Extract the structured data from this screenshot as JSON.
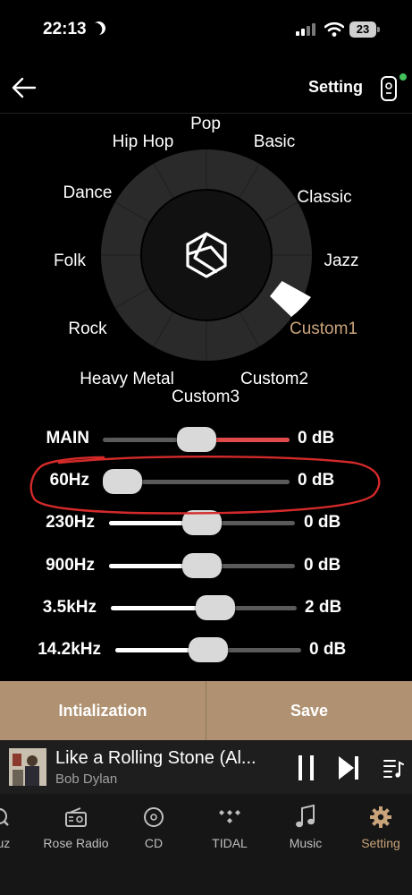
{
  "status_bar": {
    "time": "22:13",
    "battery": "23"
  },
  "header": {
    "title": "Setting"
  },
  "dial": {
    "labels": {
      "pop": "Pop",
      "hiphop": "Hip Hop",
      "basic": "Basic",
      "dance": "Dance",
      "classic": "Classic",
      "folk": "Folk",
      "jazz": "Jazz",
      "rock": "Rock",
      "custom1": "Custom1",
      "heavy_metal": "Heavy Metal",
      "custom2": "Custom2",
      "custom3": "Custom3"
    },
    "selected": "Custom1"
  },
  "bands": [
    {
      "label": "MAIN",
      "value": "0 dB",
      "level": 0.5
    },
    {
      "label": "60Hz",
      "value": "0 dB",
      "level": 0.0
    },
    {
      "label": "230Hz",
      "value": "0 dB",
      "level": 0.5
    },
    {
      "label": "900Hz",
      "value": "0 dB",
      "level": 0.5
    },
    {
      "label": "3.5kHz",
      "value": "2 dB",
      "level": 0.58
    },
    {
      "label": "14.2kHz",
      "value": "0 dB",
      "level": 0.5
    }
  ],
  "buttons": {
    "init": "Intialization",
    "save": "Save"
  },
  "player": {
    "title": "Like a Rolling Stone (Al...",
    "artist": "Bob Dylan"
  },
  "tabs": {
    "qobuz": "ouz",
    "rose_radio": "Rose Radio",
    "cd": "CD",
    "tidal": "TIDAL",
    "music": "Music",
    "setting": "Setting"
  },
  "colors": {
    "accent": "#c9a37a",
    "main_fill": "#e04a4a",
    "annotation": "#d42a2a",
    "button_bg": "#b09272"
  }
}
